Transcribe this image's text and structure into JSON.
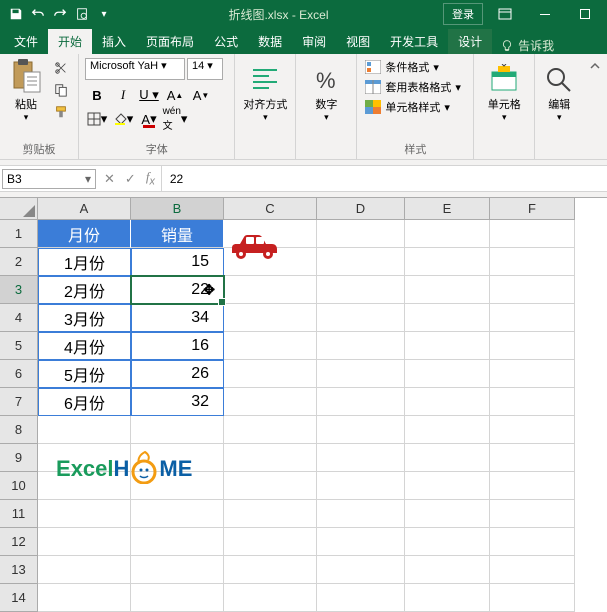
{
  "titlebar": {
    "filename": "折线图.xlsx",
    "app": "Excel",
    "login": "登录"
  },
  "tabs": {
    "file": "文件",
    "home": "开始",
    "insert": "插入",
    "layout": "页面布局",
    "formulas": "公式",
    "data": "数据",
    "review": "审阅",
    "view": "视图",
    "dev": "开发工具",
    "design": "设计",
    "tellme": "告诉我"
  },
  "ribbon": {
    "clipboard": {
      "paste": "粘贴",
      "label": "剪贴板"
    },
    "font": {
      "name": "Microsoft YaH",
      "size": "14",
      "label": "字体"
    },
    "alignment": {
      "label": "对齐方式"
    },
    "number": {
      "label": "数字"
    },
    "styles": {
      "cond": "条件格式",
      "table": "套用表格格式",
      "cell": "单元格样式",
      "label": "样式"
    },
    "cells": {
      "label": "单元格"
    },
    "editing": {
      "label": "编辑"
    }
  },
  "namebox": "B3",
  "formula_value": "22",
  "columns": [
    "A",
    "B",
    "C",
    "D",
    "E",
    "F"
  ],
  "rows": [
    1,
    2,
    3,
    4,
    5,
    6,
    7,
    8,
    9,
    10,
    11,
    12,
    13,
    14
  ],
  "table": {
    "header": {
      "month": "月份",
      "sales": "销量"
    },
    "rows": [
      {
        "m": "1月份",
        "v": "15"
      },
      {
        "m": "2月份",
        "v": "22"
      },
      {
        "m": "3月份",
        "v": "34"
      },
      {
        "m": "4月份",
        "v": "16"
      },
      {
        "m": "5月份",
        "v": "26"
      },
      {
        "m": "6月份",
        "v": "32"
      }
    ]
  },
  "logo": {
    "p1": "E",
    "p2": "xcel",
    "p3": "H",
    "p4": "ME"
  },
  "chart_data": {
    "type": "table",
    "title": "销量",
    "categories": [
      "1月份",
      "2月份",
      "3月份",
      "4月份",
      "5月份",
      "6月份"
    ],
    "values": [
      15,
      22,
      34,
      16,
      26,
      32
    ],
    "xlabel": "月份",
    "ylabel": "销量"
  }
}
